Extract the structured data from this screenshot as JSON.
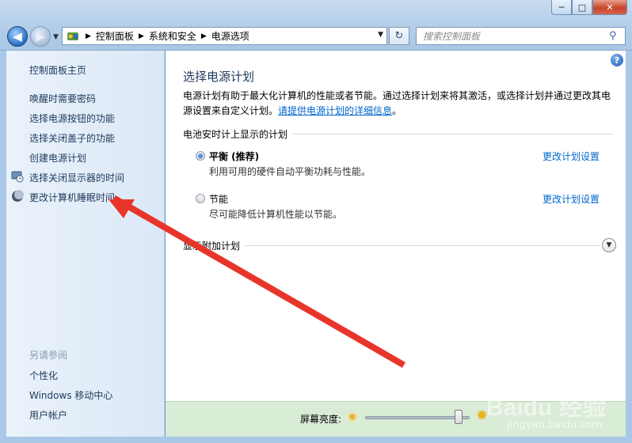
{
  "window": {
    "minimize": "─",
    "maximize": "□",
    "close": "✕"
  },
  "address": {
    "crumbs": [
      "控制面板",
      "系统和安全",
      "电源选项"
    ]
  },
  "search": {
    "placeholder": "搜索控制面板"
  },
  "sidebar": {
    "home": "控制面板主页",
    "items": [
      {
        "label": "唤醒时需要密码",
        "icon": ""
      },
      {
        "label": "选择电源按钮的功能",
        "icon": ""
      },
      {
        "label": "选择关闭盖子的功能",
        "icon": ""
      },
      {
        "label": "创建电源计划",
        "icon": ""
      },
      {
        "label": "选择关闭显示器的时间",
        "icon": "monitor-clock-icon"
      },
      {
        "label": "更改计算机睡眠时间",
        "icon": "moon-icon"
      }
    ],
    "see_also_title": "另请参阅",
    "see_also": [
      "个性化",
      "Windows 移动中心",
      "用户帐户"
    ]
  },
  "main": {
    "title": "选择电源计划",
    "description": "电源计划有助于最大化计算机的性能或者节能。通过选择计划来将其激活，或选择计划并通过更改其电源设置来自定义计划。",
    "description_link": "请提供电源计划的详细信息",
    "description_end": "。",
    "group_label": "电池安时计上显示的计划",
    "plans": [
      {
        "name": "平衡 (推荐)",
        "desc": "利用可用的硬件自动平衡功耗与性能。",
        "selected": true,
        "link": "更改计划设置"
      },
      {
        "name": "节能",
        "desc": "尽可能降低计算机性能以节能。",
        "selected": false,
        "link": "更改计划设置"
      }
    ],
    "more_plans": "显示附加计划"
  },
  "brightness": {
    "label": "屏幕亮度:",
    "level_percent": 93
  },
  "watermark": {
    "brand": "Baidu 经验",
    "url": "jingyan.baidu.com"
  },
  "colors": {
    "accent_link": "#0066cc",
    "arrow": "#e8352b"
  }
}
